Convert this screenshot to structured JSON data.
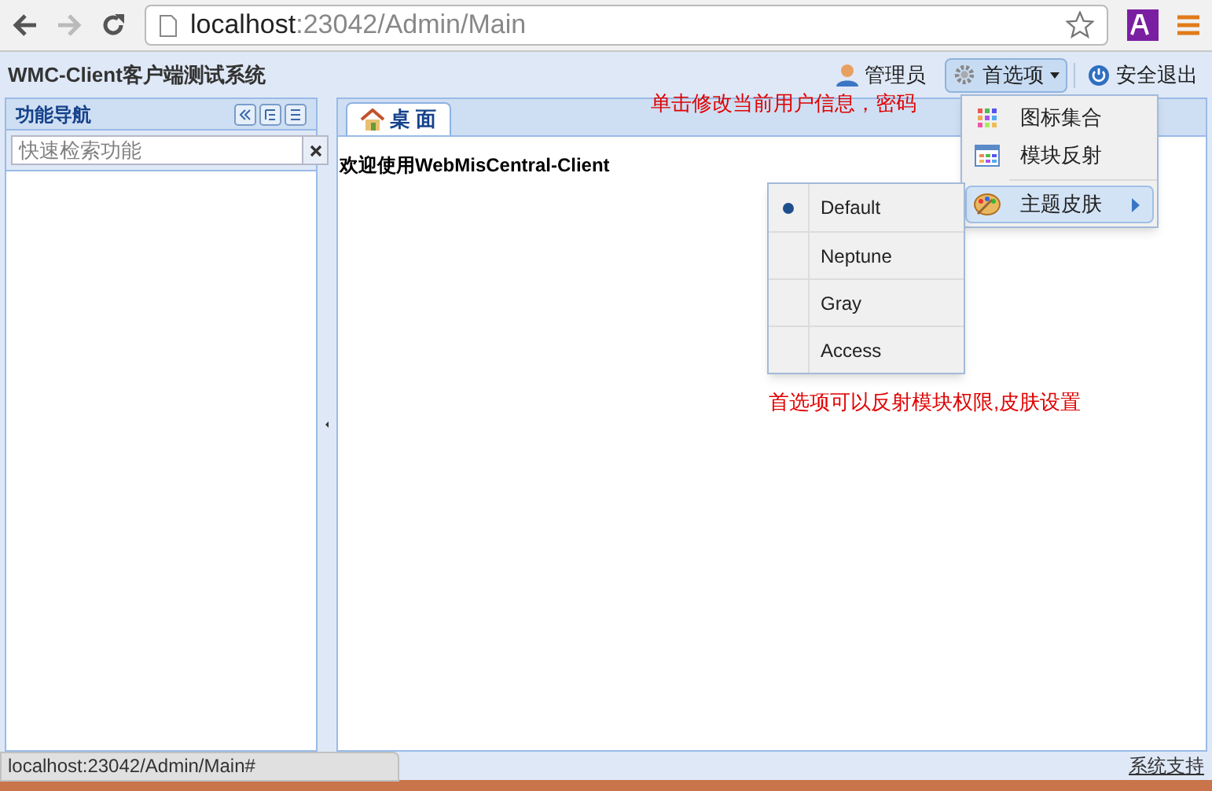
{
  "browser": {
    "url_host": "localhost",
    "url_path": ":23042/Admin/Main"
  },
  "header": {
    "title": "WMC-Client客户端测试系统",
    "user": "管理员",
    "preferences": {
      "label": "首选项",
      "expanded": true
    },
    "logout": "安全退出"
  },
  "sidebar": {
    "title": "功能导航",
    "search": {
      "placeholder": "快速检索功能"
    }
  },
  "tabs": [
    {
      "label": "桌 面",
      "selected": true
    }
  ],
  "welcome": "欢迎使用WebMisCentral-Client",
  "preferences_menu": [
    {
      "label": "图标集合",
      "kind": "grid",
      "highlighted": false,
      "submenu": false
    },
    {
      "label": "模块反射",
      "kind": "table",
      "highlighted": false,
      "submenu": false
    },
    {
      "label": "主题皮肤",
      "kind": "palette",
      "highlighted": true,
      "submenu": true
    }
  ],
  "theme_menu": [
    {
      "label": "Default",
      "selected": true
    },
    {
      "label": "Neptune",
      "selected": false
    },
    {
      "label": "Gray",
      "selected": false
    },
    {
      "label": "Access",
      "selected": false
    }
  ],
  "annotations": [
    "单击修改当前用户信息，密码",
    "首选项可以反射模块权限,皮肤设置"
  ],
  "status_url": "localhost:23042/Admin/Main#",
  "footer_link": "系统支持"
}
